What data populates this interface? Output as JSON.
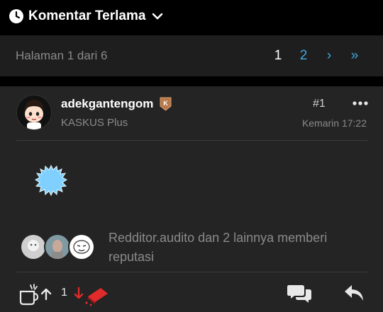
{
  "sort": {
    "label": "Komentar Terlama",
    "icon": "clock-icon",
    "chevron": "chevron-down-icon"
  },
  "pager": {
    "info": "Halaman 1 dari 6",
    "current": "1",
    "page2": "2",
    "next": "›",
    "last": "»",
    "link_color": "#3ea9e6"
  },
  "post": {
    "username": "adekgantengom",
    "user_title": "KASKUS Plus",
    "number": "#1",
    "timestamp": "Kemarin 17:22",
    "reputation_text": "Redditor.audito dan 2 lainnya memberi reputasi",
    "vote_count": "1"
  },
  "colors": {
    "badge": "#b8794a",
    "downvote": "#e02b2b",
    "link": "#3ea9e6",
    "sticker": "#7fd0ff"
  }
}
